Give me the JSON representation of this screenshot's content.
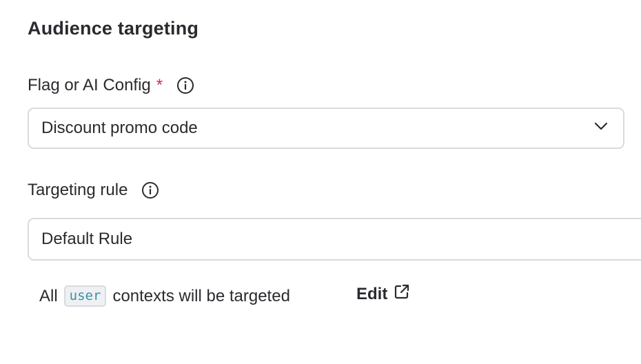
{
  "section": {
    "title": "Audience targeting"
  },
  "flag_field": {
    "label": "Flag or AI Config",
    "required_mark": "*",
    "selected_value": "Discount promo code"
  },
  "rule_field": {
    "label": "Targeting rule",
    "value": "Default Rule"
  },
  "summary": {
    "prefix": "All",
    "context_kind": "user",
    "suffix": "contexts will be targeted",
    "edit_label": "Edit"
  },
  "colors": {
    "required": "#d3275b",
    "code_text": "#3a8ea0",
    "border": "#d9dade"
  }
}
